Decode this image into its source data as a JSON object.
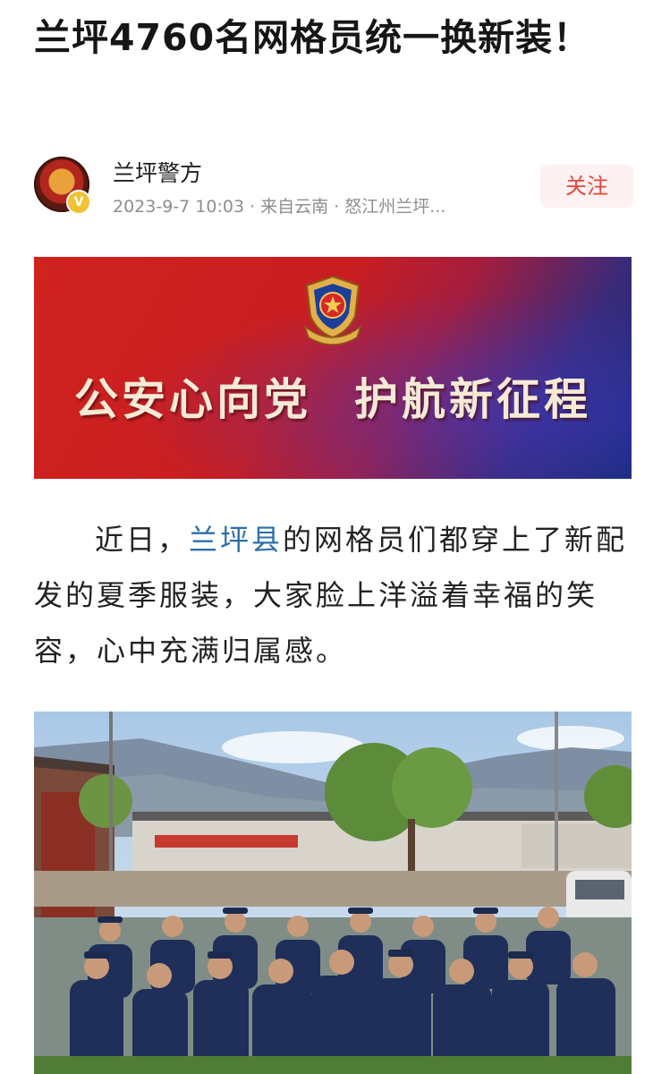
{
  "article": {
    "title": "兰坪4760名网格员统一换新装！"
  },
  "author": {
    "name": "兰坪警方",
    "meta": "2023-9-7 10:03 · 来自云南 · 怒江州兰坪...",
    "follow_label": "关注",
    "verified_icon": "verified-v-badge"
  },
  "banner": {
    "slogan_left": "公安心向党",
    "slogan_right": "护航新征程",
    "emblem_icon": "police-emblem",
    "colors": {
      "red": "#d0231f",
      "blue": "#162a78",
      "text": "#f6ead6"
    }
  },
  "body": {
    "para_before_link": "近日，",
    "para_link": "兰坪县",
    "para_after_link": "的网格员们都穿上了新配发的夏季服装，大家脸上洋溢着幸福的笑容，心中充满归属感。"
  },
  "photo": {
    "description_icon": "group-photo-image"
  },
  "colors": {
    "accent": "#e8453c",
    "link": "#2d6ea8",
    "meta_text": "#8d8d8d"
  }
}
